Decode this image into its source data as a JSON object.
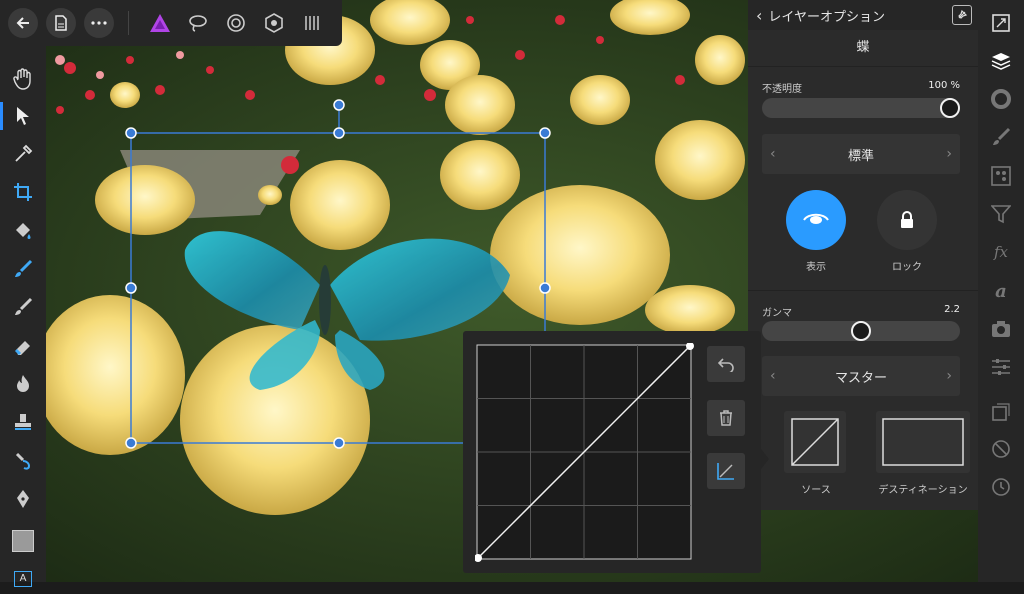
{
  "toolbar": {
    "icons": [
      "back-icon",
      "document-icon",
      "more-icon",
      "persona-photo-icon",
      "selection-lasso-icon",
      "liquify-icon",
      "develop-icon",
      "export-icon"
    ]
  },
  "left_tools": {
    "icons": [
      "hand-icon",
      "move-icon",
      "eyedropper-icon",
      "crop-icon",
      "fill-icon",
      "paint-brush-icon",
      "pixel-brush-icon",
      "eraser-icon",
      "burn-icon",
      "clone-icon",
      "smudge-icon",
      "pen-icon",
      "color-swatch-icon",
      "text-icon"
    ]
  },
  "right_strip": {
    "icons": [
      "canvas-icon",
      "layers-icon",
      "color-icon",
      "brushes-icon",
      "channels-icon",
      "filters-icon",
      "fx-icon",
      "text-style-icon",
      "camera-icon",
      "adjustments-icon",
      "transform-icon",
      "stock-icon",
      "history-icon"
    ]
  },
  "panel": {
    "title": "レイヤーオプション",
    "layer_name": "蝶",
    "opacity_label": "不透明度",
    "opacity_value": "100 %",
    "opacity_fraction": 1.0,
    "blend_mode": "標準",
    "visible_label": "表示",
    "lock_label": "ロック",
    "gamma_label": "ガンマ",
    "gamma_value": "2.2",
    "gamma_fraction": 0.5,
    "channel": "マスター",
    "source_label": "ソース",
    "destination_label": "デスティネーション"
  },
  "colors": {
    "accent": "#2a9bff",
    "panel_bg": "#2b2b2b",
    "selection": "#3a7bd5"
  }
}
